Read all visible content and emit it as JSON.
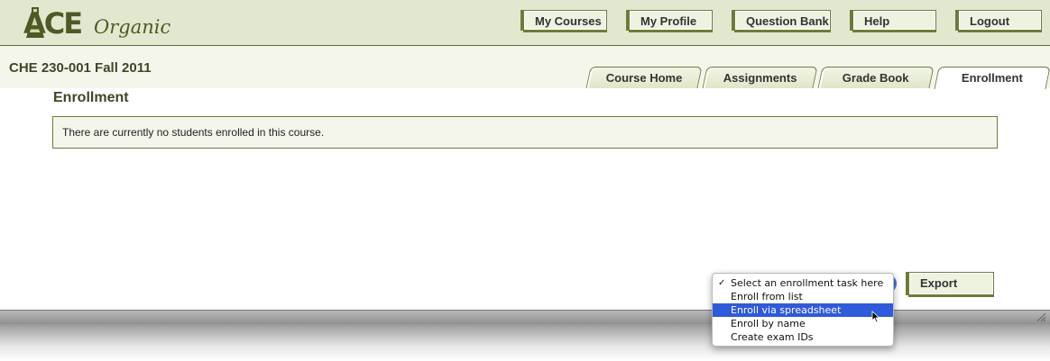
{
  "logo": {
    "ace": "ACE",
    "organic": "Organic"
  },
  "nav": {
    "my_courses": "My Courses",
    "my_profile": "My Profile",
    "question_bank": "Question Bank",
    "help": "Help",
    "logout": "Logout"
  },
  "course": {
    "title": "CHE 230-001 Fall 2011"
  },
  "tabs": [
    {
      "label": "Course Home",
      "active": false
    },
    {
      "label": "Assignments",
      "active": false
    },
    {
      "label": "Grade Book",
      "active": false
    },
    {
      "label": "Enrollment",
      "active": true
    }
  ],
  "main": {
    "heading": "Enrollment",
    "notice": "There are currently no students enrolled in this course."
  },
  "enrollment_menu": {
    "selected": "Select an enrollment task here",
    "options": [
      "Select an enrollment task here",
      "Enroll from list",
      "Enroll via spreadsheet",
      "Enroll by name",
      "Create exam IDs"
    ],
    "highlighted": "Enroll via spreadsheet"
  },
  "export": {
    "label": "Export"
  },
  "colors": {
    "header_bg": "#e1e8cf",
    "accent_olive": "#6e7b3f",
    "highlight_blue": "#2f5ad9"
  },
  "icons": [
    "flask-icon",
    "checkmark-icon",
    "resize-grip-icon",
    "mouse-cursor-icon"
  ]
}
